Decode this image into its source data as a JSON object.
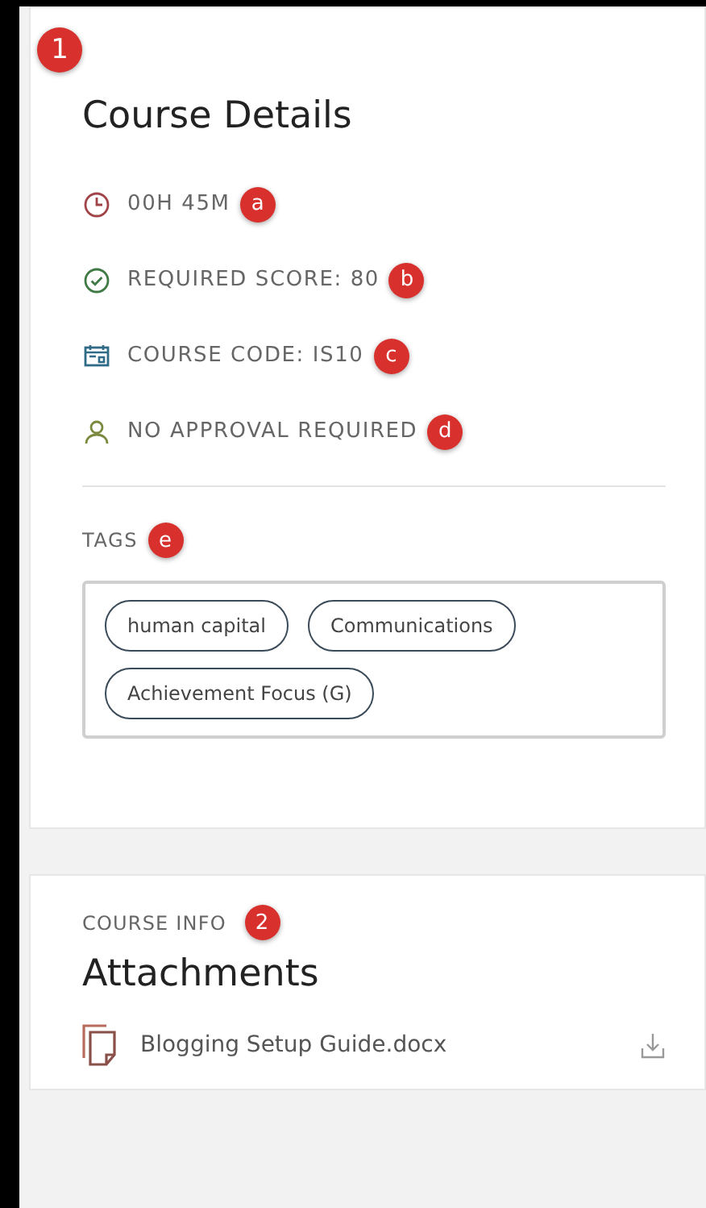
{
  "details": {
    "marker": "1",
    "title": "Course Details",
    "items": [
      {
        "kind": "clock",
        "text": "00H 45M",
        "marker": "a"
      },
      {
        "kind": "check",
        "text": "REQUIRED SCORE: 80",
        "marker": "b"
      },
      {
        "kind": "calendar",
        "text": "COURSE CODE: IS10",
        "marker": "c"
      },
      {
        "kind": "person",
        "text": "NO APPROVAL REQUIRED",
        "marker": "d"
      }
    ],
    "tags_label": "TAGS",
    "tags_marker": "e",
    "tags": [
      "human capital",
      "Communications",
      "Achievement Focus (G)"
    ]
  },
  "info": {
    "label": "COURSE INFO",
    "marker": "2",
    "title": "Attachments",
    "attachments": [
      {
        "name": "Blogging Setup Guide.docx"
      }
    ]
  }
}
